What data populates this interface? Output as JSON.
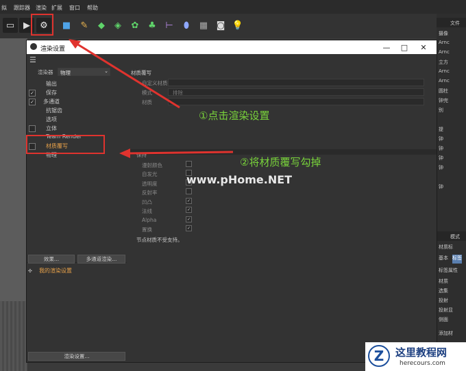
{
  "menu": [
    "拟",
    "跟踪器",
    "渲染",
    "扩展",
    "窗口",
    "帮助"
  ],
  "dialog": {
    "title": "渲染设置",
    "renderer_label": "渲染器",
    "renderer_value": "物理",
    "sections": [
      "输出",
      "保存",
      "多通道",
      "抗锯齿",
      "选项",
      "立体",
      "Team Render",
      "材质覆写",
      "物理"
    ],
    "effect_button": "效果...",
    "multipass_button": "多通道渲染...",
    "my_setting": "我的渲染设置",
    "bottom_button": "渲染设置..."
  },
  "panel": {
    "heading": "材质覆写",
    "custom_material": "自定义材质",
    "mode_label": "模式",
    "mode_value": "排除",
    "material_label": "材质",
    "keep_heading": "保持",
    "keep_items": [
      "漫射颜色",
      "自发光",
      "透明度",
      "反射率",
      "凹凸",
      "法线",
      "Alpha",
      "置换"
    ],
    "note": "节点材质不受支持。"
  },
  "right_panel": {
    "header_file": "文件",
    "items": [
      "摄像",
      "Arnc",
      "Arnc",
      "立方",
      "Arnc",
      "Arnc",
      "圆柱",
      "钟完",
      "别",
      "提",
      "钟",
      "钟",
      "钟",
      "钟",
      "钟"
    ],
    "header_mode": "模式",
    "mat": "材质标",
    "tabs": [
      "基本",
      "标签"
    ],
    "tag_props": "标签属性",
    "props": [
      "材质",
      "选集",
      "投射",
      "投射显",
      "侧面",
      "添加材"
    ]
  },
  "annotations": {
    "step1": "①点击渲染设置",
    "step2": "②将材质覆写勾掉"
  },
  "watermark": "www.pHome.NET",
  "logo": {
    "cn": "这里教程网",
    "url": "herecours.com"
  },
  "colors": {
    "accent_green": "#79d33b",
    "red_box": "#e0332e",
    "highlight_orange": "#e8a24a"
  }
}
